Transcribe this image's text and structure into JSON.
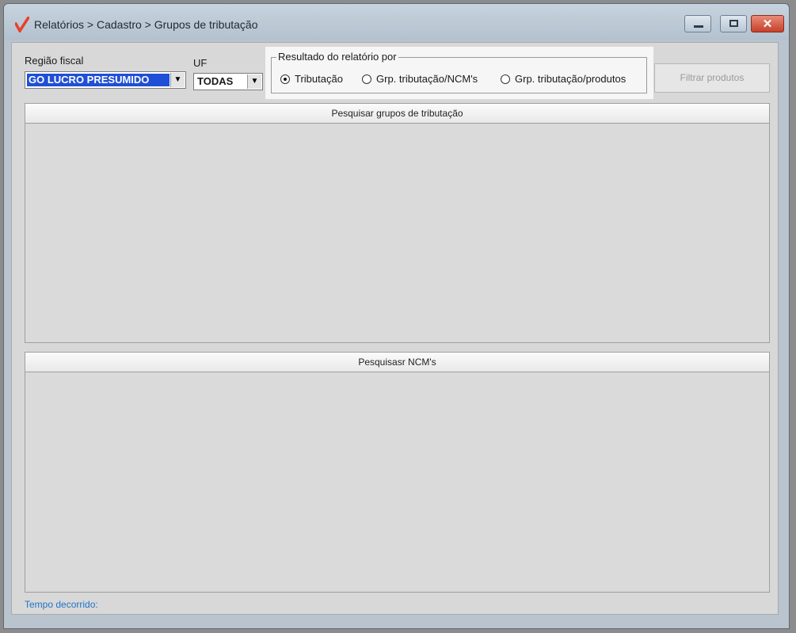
{
  "window": {
    "title": "Relatórios > Cadastro > Grupos de tributação"
  },
  "filters": {
    "regiao_label": "Região fiscal",
    "regiao_value": "GO LUCRO PRESUMIDO",
    "uf_label": "UF",
    "uf_value": "TODAS"
  },
  "resultado": {
    "legend": "Resultado do relatório por",
    "options": [
      {
        "label": "Tributação",
        "selected": true
      },
      {
        "label": "Grp. tributação/NCM's",
        "selected": false
      },
      {
        "label": "Grp. tributação/produtos",
        "selected": false
      }
    ]
  },
  "filter_button": "Filtrar produtos",
  "panels": {
    "grupos_title": "Pesquisar grupos de tributação",
    "ncm_title": "Pesquisasr NCM's"
  },
  "status": "Tempo decorrido:",
  "colors": {
    "accent_icon": "#e8402a",
    "selection": "#1f4fd6",
    "status_text": "#1e74c9"
  }
}
